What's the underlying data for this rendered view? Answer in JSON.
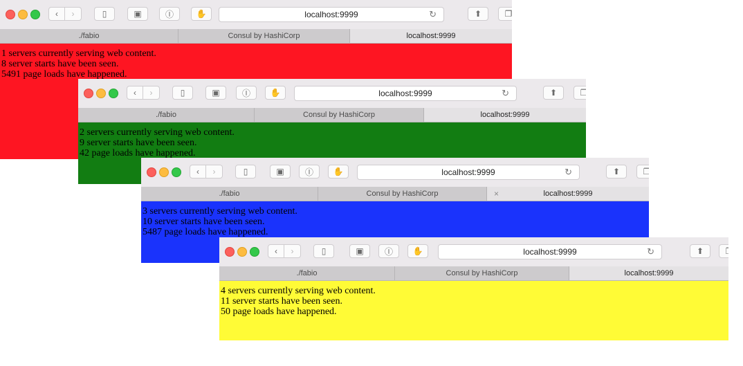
{
  "windows": [
    {
      "bg": "#fe1522",
      "address": "localhost:9999",
      "tabs": [
        "./fabio",
        "Consul by HashiCorp",
        "localhost:9999"
      ],
      "lines": [
        "1 servers currently serving web content.",
        "8 server starts have been seen.",
        "5491 page loads have happened."
      ]
    },
    {
      "bg": "#127d12",
      "address": "localhost:9999",
      "tabs": [
        "./fabio",
        "Consul by HashiCorp",
        "localhost:9999"
      ],
      "lines": [
        "2 servers currently serving web content.",
        "9 server starts have been seen.",
        "42 page loads have happened."
      ]
    },
    {
      "bg": "#1a33fc",
      "address": "localhost:9999",
      "tabs": [
        "./fabio",
        "Consul by HashiCorp",
        "localhost:9999"
      ],
      "tab_close_glyph": "×",
      "lines": [
        "3 servers currently serving web content.",
        "10 server starts have been seen.",
        "5487 page loads have happened."
      ]
    },
    {
      "bg": "#fffb36",
      "address": "localhost:9999",
      "tabs": [
        "./fabio",
        "Consul by HashiCorp",
        "localhost:9999"
      ],
      "lines": [
        "4 servers currently serving web content.",
        "11 server starts have been seen.",
        "50 page loads have happened."
      ]
    }
  ],
  "icons": {
    "back": "back-chevron-icon",
    "forward": "forward-chevron-icon",
    "sidebar": "sidebar-icon",
    "onenote": "onenote-icon",
    "password": "password-manager-icon",
    "extension": "extension-icon",
    "reload": "reload-icon",
    "share": "share-icon",
    "tabs": "tabs-icon"
  }
}
